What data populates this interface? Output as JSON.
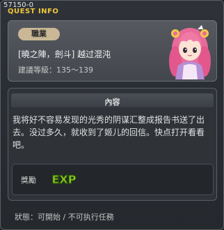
{
  "header": {
    "quest_id": "57150-0",
    "title": "QUEST INFO"
  },
  "quest": {
    "category": "職業",
    "name": "[曉之陣，劍斗] 越过混沌",
    "level": "建議等級：135～139"
  },
  "content": {
    "title": "內容",
    "description": "我将好不容易发现的光秀的阴谋汇整成报告书送了出去。没过多久，就收到了姬儿的回信。快点打开看看吧。"
  },
  "reward": {
    "label": "獎勵",
    "exp_text": "EXP"
  },
  "status": {
    "text": "狀態：可開始 / 不可执行任務"
  },
  "colors": {
    "title_gold": "#f0c83c",
    "exp_green": "#9be023",
    "badge_tan": "#c9b796"
  },
  "icons": [
    "npc-portrait",
    "exp-icon"
  ]
}
